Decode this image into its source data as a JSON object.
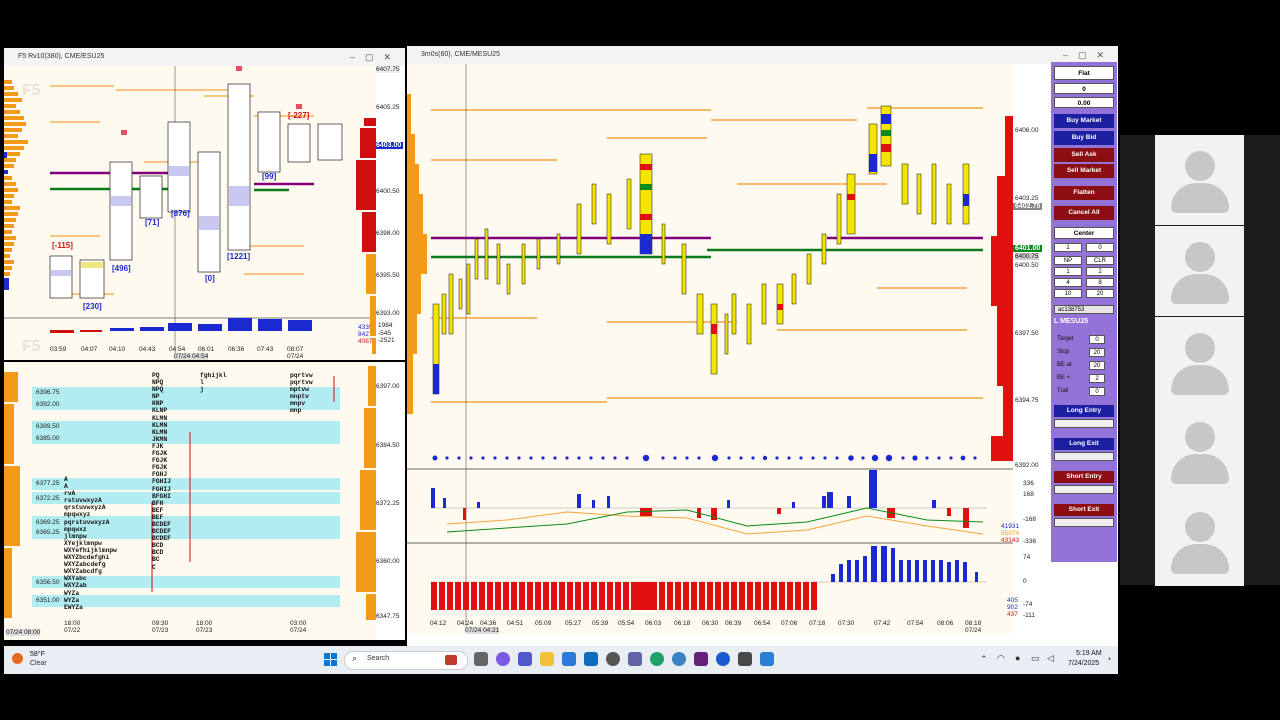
{
  "left_top_window": {
    "title": "F5 Rv10(380), CME/ESU25",
    "watermark": "F5",
    "price_axis": [
      "6407.75",
      "6405.25",
      "6403.00",
      "6400.50",
      "6398.00",
      "6395.50",
      "6393.00"
    ],
    "current_price": "6403.00",
    "bottom_axis_vals": [
      "43397",
      "84270",
      "40873",
      "1984",
      "-545",
      "-2521"
    ],
    "time_axis": [
      "03:59",
      "04:07",
      "04:10",
      "04:43",
      "04:54",
      "06:01",
      "06:36",
      "07:43",
      "08:07"
    ],
    "time_axis_sub": [
      "07/24 04:54",
      "07/24"
    ],
    "bar_labels": [
      "[-115]",
      "[230]",
      "[496]",
      "[71]",
      "[876]",
      "[0]",
      "[1221]",
      "[99]",
      "[-227]"
    ]
  },
  "left_bottom_window": {
    "watermark": "F5",
    "price_axis": [
      "6397.00",
      "6384.50",
      "6372.25",
      "6360.00",
      "6347.75"
    ],
    "level_labels": [
      "6396.75",
      "6392.00",
      "6389.50",
      "6385.00",
      "6377.25",
      "6372.25",
      "6369.25",
      "6365.25",
      "6356.50",
      "6351.00"
    ],
    "time_axis": [
      "18:00",
      "09:30",
      "18:00",
      "03:00"
    ],
    "date_axis": [
      "07/22",
      "07/23",
      "07/23",
      "07/24"
    ],
    "corner_date": "07/24 08:00"
  },
  "main_window": {
    "title": "3m0s(60), CME/MESU25",
    "price_axis": [
      "6406.00",
      "6403.25",
      "6400.50",
      "6397.50",
      "6394.75",
      "6392.00"
    ],
    "current_price": "6402.75",
    "green_flag": "6401.00",
    "gray_flag": "6400.75",
    "delta_axis": [
      "336",
      "168",
      "-168",
      "-336"
    ],
    "delta_vals": [
      "41931",
      "85074",
      "43143"
    ],
    "cvd_axis": [
      "74",
      "0",
      "-74",
      "-111"
    ],
    "cvd_vals": [
      "405",
      "902",
      "437"
    ],
    "time_axis": [
      "04:12",
      "04:24",
      "04:36",
      "04:51",
      "05:09",
      "05:27",
      "05:39",
      "05:54",
      "06:03",
      "06:18",
      "06:30",
      "06:39",
      "06:54",
      "07:06",
      "07:18",
      "07:30",
      "07:42",
      "07:54",
      "08:06",
      "08:18"
    ],
    "time_axis_sub": [
      "07/24 04:21",
      "07/24"
    ]
  },
  "order_panel": {
    "position": "Flat",
    "qty": "0",
    "pnl": "0.00",
    "buy_market": "Buy Market",
    "buy_bid": "Buy Bid",
    "sell_ask": "Sell Ask",
    "sell_market": "Sell Market",
    "flatten": "Flatten",
    "cancel_all": "Cancel All",
    "center": "Center",
    "qty_spin": "1",
    "qty_right": "0",
    "np": "NP",
    "clr": "CLR",
    "grid": [
      "1",
      "2",
      "4",
      "8",
      "10",
      "20"
    ],
    "account": "ac138753",
    "symbol": "L MESU25",
    "target_label": "Target",
    "target_val": "0",
    "stop_label": "Stop",
    "stop_val": "20",
    "beat_label": "BE at",
    "beat_val": "20",
    "beplus_label": "BE +",
    "beplus_val": "2",
    "trail_label": "Trail",
    "trail_val": "0",
    "long_entry": "Long Entry",
    "long_exit": "Long Exit",
    "short_entry": "Short Entry",
    "short_exit": "Short Exit"
  },
  "taskbar": {
    "weather_temp": "58°F",
    "weather_desc": "Clear",
    "search_placeholder": "Search",
    "time": "5:19 AM",
    "date": "7/24/2025"
  },
  "colors": {
    "accent_purple": "#9473d8",
    "buy_blue": "#1a20a0",
    "sell_red": "#8b0e12",
    "chart_bg": "#fffaf0"
  }
}
